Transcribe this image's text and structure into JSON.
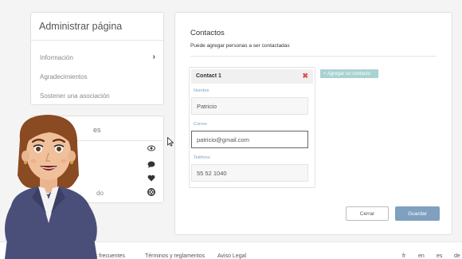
{
  "admin": {
    "title": "Administrar página",
    "items": [
      {
        "label": "Información"
      },
      {
        "label": "Agradecimientos"
      },
      {
        "label": "Sostener una asociación"
      }
    ]
  },
  "panel2": {
    "heading": "es",
    "items": [
      {
        "label": "",
        "icon": "eye-icon"
      },
      {
        "label": "",
        "icon": "comment-icon"
      },
      {
        "label": "",
        "icon": "heart-icon"
      },
      {
        "label": "do",
        "icon": "lifebuoy-icon"
      }
    ]
  },
  "contacts": {
    "title": "Contactos",
    "subtitle": "Puede agregar personas a ser contactadas",
    "add_button": "+ Agregar un contacto",
    "card": {
      "title": "Contact 1",
      "remove": "✖",
      "fields": [
        {
          "label": "Nombre",
          "value": "Patricio"
        },
        {
          "label": "Correo",
          "value": "patricio@gmail.com"
        },
        {
          "label": "Teléfono",
          "value": "55 52 1040"
        }
      ]
    },
    "cancel": "Cerrar",
    "save": "Guardar"
  },
  "footer": {
    "links": [
      "reguntas frecuentes",
      "Términos y reglamentos",
      "Aviso Legal"
    ],
    "languages": [
      "fr",
      "en",
      "es",
      "de"
    ]
  },
  "colors": {
    "accent": "#7fa0bf",
    "add_button": "#a9d2d2",
    "remove": "#d9534f",
    "field_label": "#7aa3c4"
  }
}
